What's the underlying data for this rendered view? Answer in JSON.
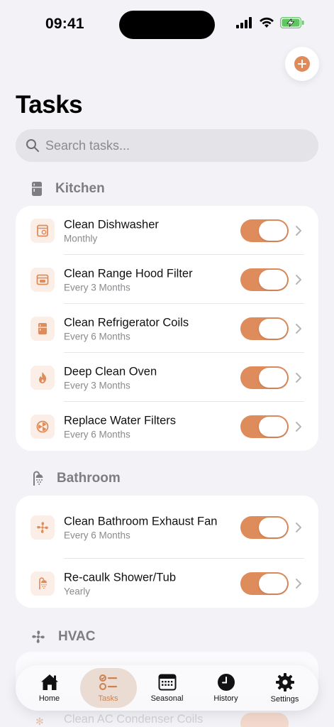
{
  "status": {
    "time": "09:41"
  },
  "page": {
    "title": "Tasks"
  },
  "search": {
    "placeholder": "Search tasks..."
  },
  "colors": {
    "accent": "#df8c5d",
    "icon_bg": "#fbeee6",
    "background": "#f2f2f7"
  },
  "sections": [
    {
      "title": "Kitchen",
      "icon": "fridge-icon",
      "tasks": [
        {
          "title": "Clean Dishwasher",
          "frequency": "Monthly",
          "icon": "dishwasher-icon",
          "enabled": true
        },
        {
          "title": "Clean Range Hood Filter",
          "frequency": "Every 3 Months",
          "icon": "oven-icon",
          "enabled": true
        },
        {
          "title": "Clean Refrigerator Coils",
          "frequency": "Every 6 Months",
          "icon": "fridge-icon",
          "enabled": true
        },
        {
          "title": "Deep Clean Oven",
          "frequency": "Every 3 Months",
          "icon": "flame-icon",
          "enabled": true
        },
        {
          "title": "Replace Water Filters",
          "frequency": "Every 6 Months",
          "icon": "filter-icon",
          "enabled": true
        }
      ]
    },
    {
      "title": "Bathroom",
      "icon": "shower-icon",
      "tasks": [
        {
          "title": "Clean Bathroom Exhaust Fan",
          "frequency": "Every 6 Months",
          "icon": "fan-icon",
          "enabled": true
        },
        {
          "title": "Re-caulk Shower/Tub",
          "frequency": "Yearly",
          "icon": "shower-icon",
          "enabled": true
        }
      ]
    },
    {
      "title": "HVAC",
      "icon": "fan-icon",
      "tasks_partial": [
        "Clean AC Condenser Coils"
      ]
    }
  ],
  "tabs": [
    {
      "label": "Home",
      "icon": "house-icon",
      "active": false
    },
    {
      "label": "Tasks",
      "icon": "checklist-icon",
      "active": true
    },
    {
      "label": "Seasonal",
      "icon": "calendar-icon",
      "active": false
    },
    {
      "label": "History",
      "icon": "clock-icon",
      "active": false
    },
    {
      "label": "Settings",
      "icon": "gear-icon",
      "active": false
    }
  ]
}
